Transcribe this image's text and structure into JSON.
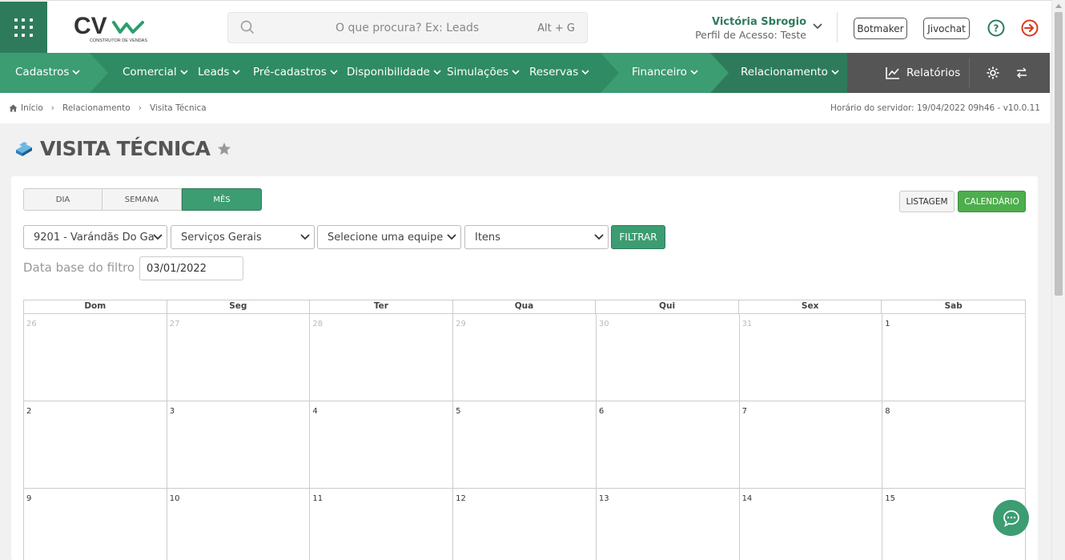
{
  "header": {
    "search_placeholder": "O que procura? Ex: Leads",
    "search_shortcut": "Alt + G",
    "user_name": "Victória Sbrogio",
    "user_profile": "Perfil de Acesso: Teste",
    "botmaker": "Botmaker",
    "jivochat": "Jivochat",
    "logo_text": "CV",
    "logo_sub": "CONSTRUTOR DE VENDAS"
  },
  "nav": {
    "items": [
      "Cadastros",
      "Comercial",
      "Leads",
      "Pré-cadastros",
      "Disponibilidade",
      "Simulações",
      "Reservas",
      "Financeiro",
      "Relacionamento"
    ],
    "relatorios": "Relatórios"
  },
  "breadcrumb": {
    "items": [
      "Início",
      "Relacionamento",
      "Visita Técnica"
    ],
    "server": "Horário do servidor: 19/04/2022 09h46 - v10.0.11"
  },
  "page": {
    "title": "VISITA TÉCNICA"
  },
  "view_tabs": [
    "DIA",
    "SEMANA",
    "MÊS"
  ],
  "active_view_tab": "MÊS",
  "view_mode": {
    "listagem": "LISTAGEM",
    "calendario": "CALENDÁRIO"
  },
  "filters": {
    "empreendimento": "9201 - Varándãs Do Ga",
    "servico": "Serviços Gerais",
    "equipe": "Selecione uma equipe",
    "itens": "Itens",
    "filter_button": "FILTRAR",
    "date_label": "Data base do filtro",
    "date_value": "03/01/2022"
  },
  "calendar": {
    "weekdays": [
      "Dom",
      "Seg",
      "Ter",
      "Qua",
      "Qui",
      "Sex",
      "Sab"
    ],
    "weeks": [
      [
        {
          "d": "26",
          "m": true
        },
        {
          "d": "27",
          "m": true
        },
        {
          "d": "28",
          "m": true
        },
        {
          "d": "29",
          "m": true
        },
        {
          "d": "30",
          "m": true
        },
        {
          "d": "31",
          "m": true
        },
        {
          "d": "1",
          "m": false
        }
      ],
      [
        {
          "d": "2",
          "m": false
        },
        {
          "d": "3",
          "m": false
        },
        {
          "d": "4",
          "m": false
        },
        {
          "d": "5",
          "m": false
        },
        {
          "d": "6",
          "m": false
        },
        {
          "d": "7",
          "m": false
        },
        {
          "d": "8",
          "m": false
        }
      ],
      [
        {
          "d": "9",
          "m": false
        },
        {
          "d": "10",
          "m": false
        },
        {
          "d": "11",
          "m": false
        },
        {
          "d": "12",
          "m": false
        },
        {
          "d": "13",
          "m": false
        },
        {
          "d": "14",
          "m": false
        },
        {
          "d": "15",
          "m": false
        }
      ]
    ]
  },
  "colors": {
    "primary": "#3c9c72",
    "dark": "#2e7b5c",
    "accent_green": "#4cae4c",
    "nav_dark": "#555555",
    "logout": "#d9381e"
  }
}
